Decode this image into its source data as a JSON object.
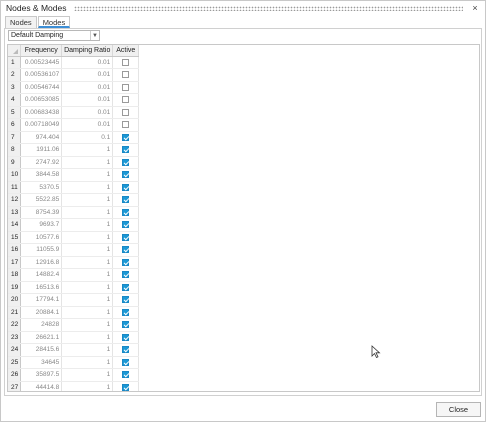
{
  "window": {
    "title": "Nodes & Modes",
    "close_glyph": "×"
  },
  "tabs": [
    {
      "label": "Nodes",
      "active": false
    },
    {
      "label": "Modes",
      "active": true
    }
  ],
  "damping_select": {
    "value": "Default Damping"
  },
  "table": {
    "columns": [
      "Frequency",
      "Damping Ratio",
      "Active"
    ],
    "rows": [
      {
        "n": "1",
        "frequency": "0.00523445",
        "damping": "0.01",
        "active": false
      },
      {
        "n": "2",
        "frequency": "0.00536107",
        "damping": "0.01",
        "active": false
      },
      {
        "n": "3",
        "frequency": "0.00546744",
        "damping": "0.01",
        "active": false
      },
      {
        "n": "4",
        "frequency": "0.00653085",
        "damping": "0.01",
        "active": false
      },
      {
        "n": "5",
        "frequency": "0.00683438",
        "damping": "0.01",
        "active": false
      },
      {
        "n": "6",
        "frequency": "0.00718049",
        "damping": "0.01",
        "active": false
      },
      {
        "n": "7",
        "frequency": "974.404",
        "damping": "0.1",
        "active": true
      },
      {
        "n": "8",
        "frequency": "1911.06",
        "damping": "1",
        "active": true
      },
      {
        "n": "9",
        "frequency": "2747.92",
        "damping": "1",
        "active": true
      },
      {
        "n": "10",
        "frequency": "3844.58",
        "damping": "1",
        "active": true
      },
      {
        "n": "11",
        "frequency": "5370.5",
        "damping": "1",
        "active": true
      },
      {
        "n": "12",
        "frequency": "5522.85",
        "damping": "1",
        "active": true
      },
      {
        "n": "13",
        "frequency": "8754.39",
        "damping": "1",
        "active": true
      },
      {
        "n": "14",
        "frequency": "9693.7",
        "damping": "1",
        "active": true
      },
      {
        "n": "15",
        "frequency": "10577.6",
        "damping": "1",
        "active": true
      },
      {
        "n": "16",
        "frequency": "11055.9",
        "damping": "1",
        "active": true
      },
      {
        "n": "17",
        "frequency": "12916.8",
        "damping": "1",
        "active": true
      },
      {
        "n": "18",
        "frequency": "14882.4",
        "damping": "1",
        "active": true
      },
      {
        "n": "19",
        "frequency": "16513.6",
        "damping": "1",
        "active": true
      },
      {
        "n": "20",
        "frequency": "17794.1",
        "damping": "1",
        "active": true
      },
      {
        "n": "21",
        "frequency": "20884.1",
        "damping": "1",
        "active": true
      },
      {
        "n": "22",
        "frequency": "24828",
        "damping": "1",
        "active": true
      },
      {
        "n": "23",
        "frequency": "26621.1",
        "damping": "1",
        "active": true
      },
      {
        "n": "24",
        "frequency": "28415.6",
        "damping": "1",
        "active": true
      },
      {
        "n": "25",
        "frequency": "34645",
        "damping": "1",
        "active": true
      },
      {
        "n": "26",
        "frequency": "35897.5",
        "damping": "1",
        "active": true
      },
      {
        "n": "27",
        "frequency": "44414.8",
        "damping": "1",
        "active": true
      }
    ]
  },
  "footer": {
    "close_label": "Close"
  },
  "colors": {
    "checkbox_checked": "#1a98d5",
    "tab_accent": "#3d8fd6"
  }
}
